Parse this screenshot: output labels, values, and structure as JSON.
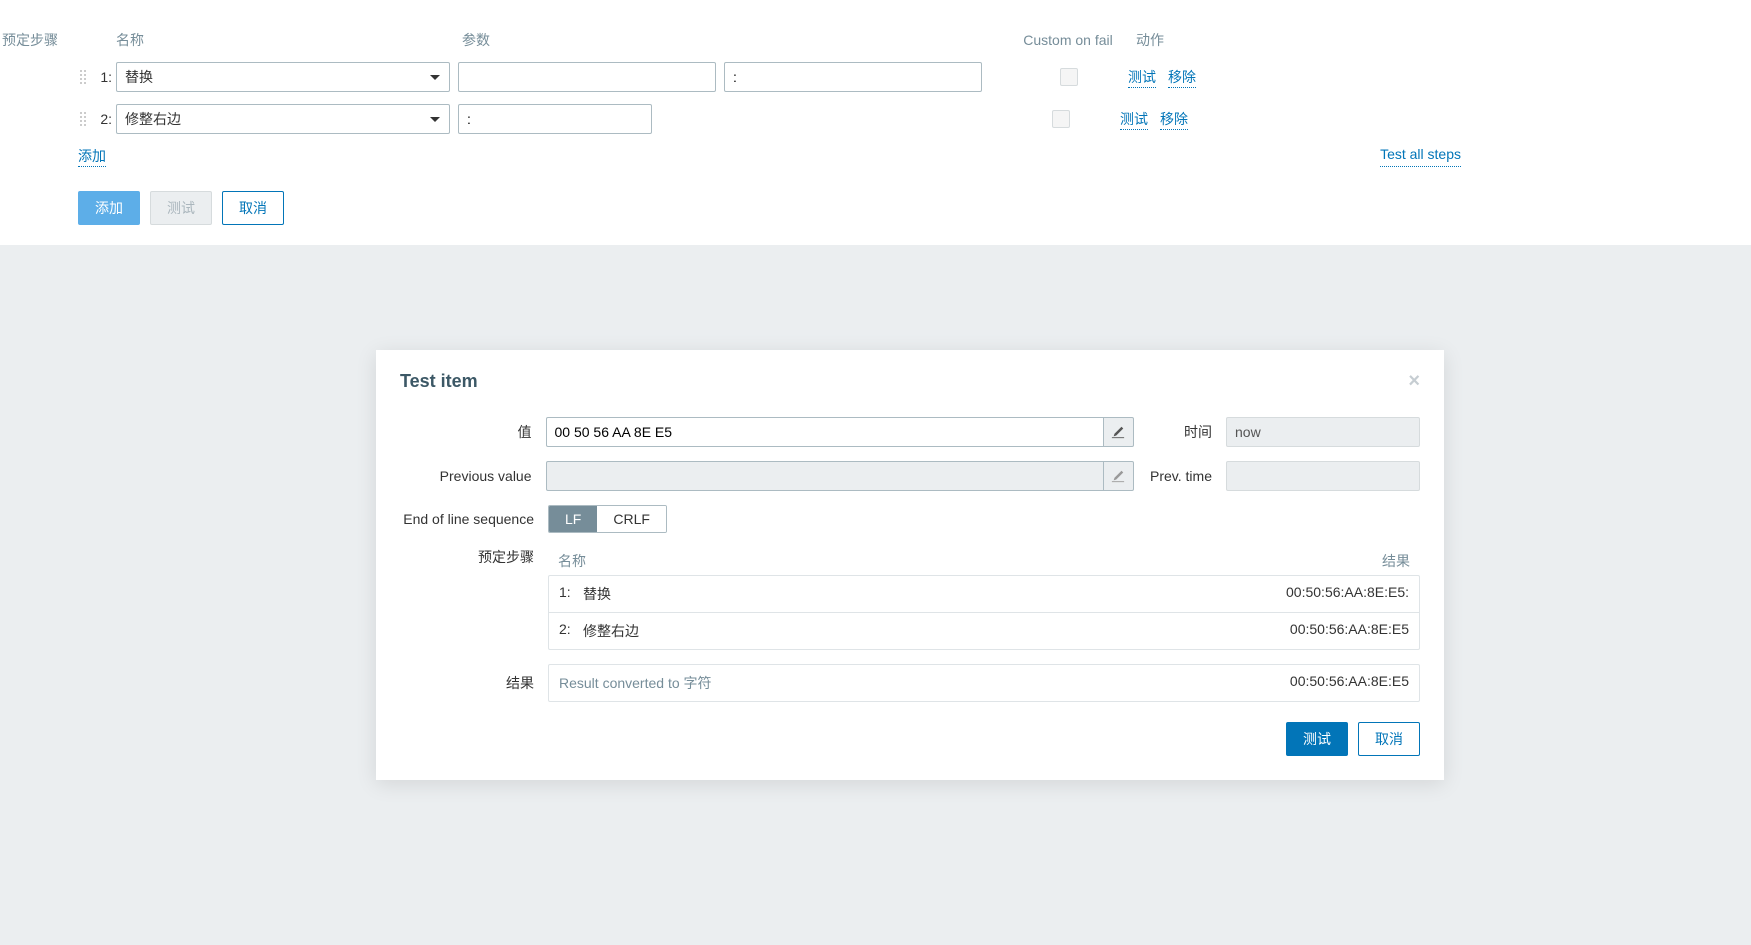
{
  "headers": {
    "preprocessing": "预定步骤",
    "name": "名称",
    "params": "参数",
    "customOnFail": "Custom on fail",
    "actions": "动作"
  },
  "steps": [
    {
      "num": "1:",
      "name": "替换",
      "param1": "",
      "param2": ":"
    },
    {
      "num": "2:",
      "name": "修整右边",
      "param1": ":",
      "param2": ""
    }
  ],
  "links": {
    "add": "添加",
    "test": "测试",
    "remove": "移除",
    "testAll": "Test all steps"
  },
  "buttons": {
    "add": "添加",
    "test": "测试",
    "cancel": "取消"
  },
  "modal": {
    "title": "Test item",
    "labels": {
      "value": "值",
      "time": "时间",
      "prevValue": "Previous value",
      "prevTime": "Prev. time",
      "eol": "End of line sequence",
      "preprocessing": "预定步骤",
      "result": "结果"
    },
    "valueInput": "00 50 56 AA 8E E5",
    "timeInput": "now",
    "prevValueInput": "",
    "prevTimeInput": "",
    "eolOptions": {
      "lf": "LF",
      "crlf": "CRLF"
    },
    "stepsHeader": {
      "name": "名称",
      "result": "结果"
    },
    "resultSteps": [
      {
        "num": "1:",
        "name": "替换",
        "result": "00:50:56:AA:8E:E5:"
      },
      {
        "num": "2:",
        "name": "修整右边",
        "result": "00:50:56:AA:8E:E5"
      }
    ],
    "resultMsg": "Result converted to 字符",
    "resultVal": "00:50:56:AA:8E:E5",
    "buttons": {
      "test": "测试",
      "cancel": "取消"
    }
  }
}
